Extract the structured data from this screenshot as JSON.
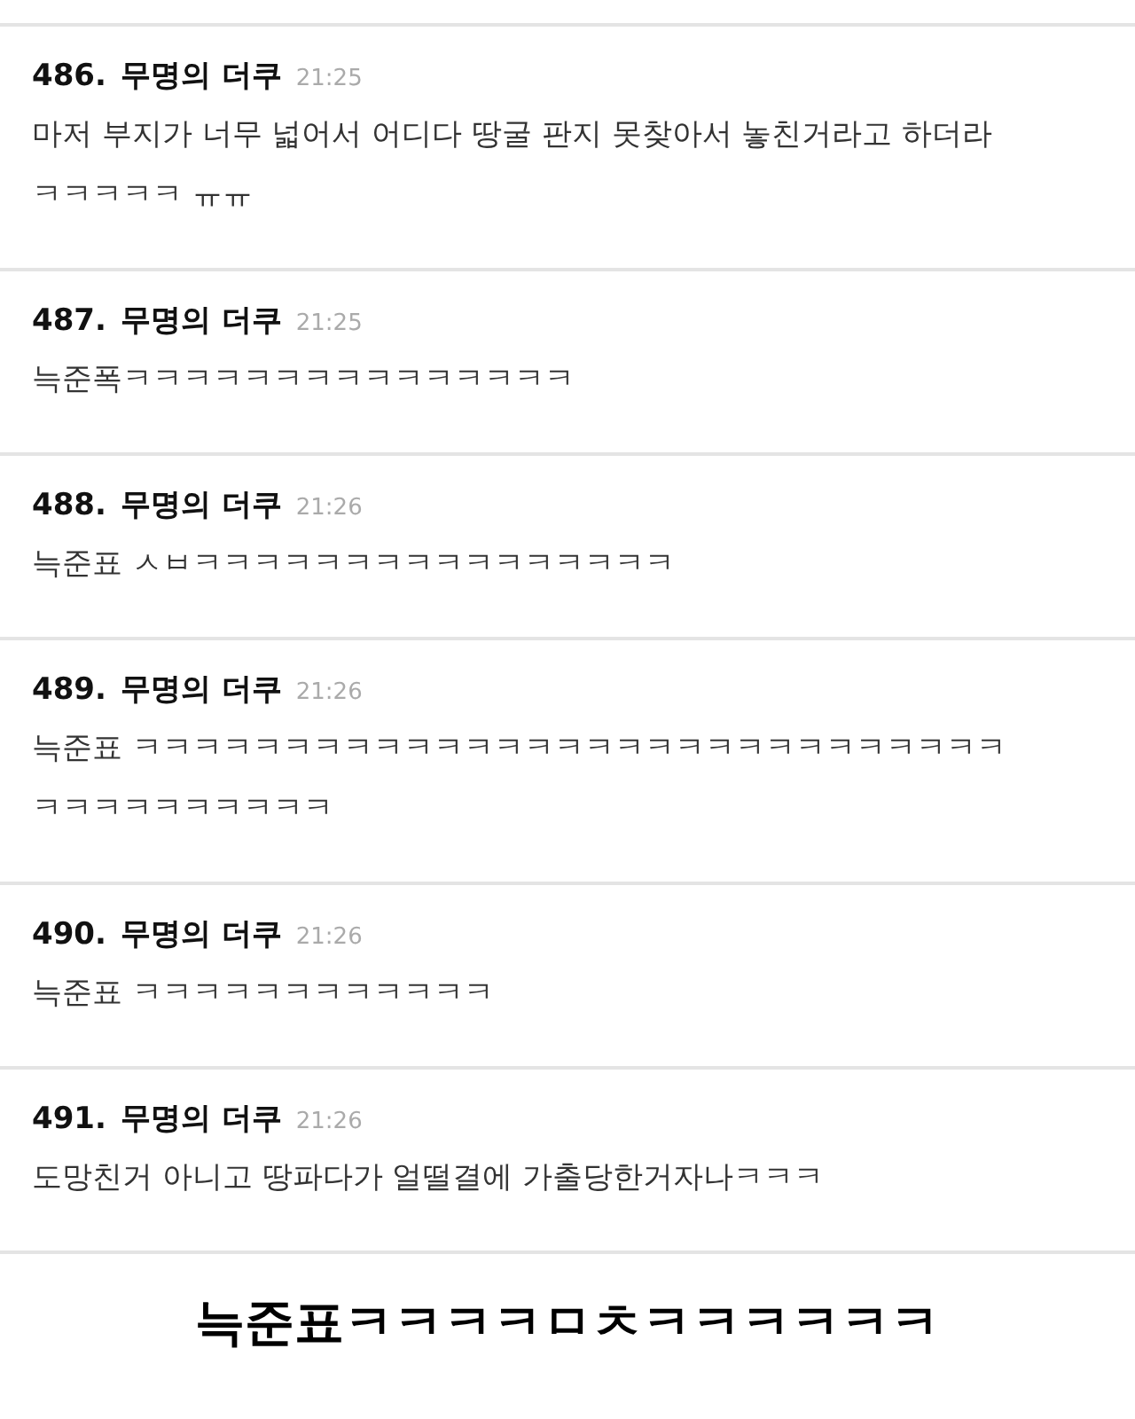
{
  "comments": [
    {
      "number": "486.",
      "author": "무명의 더쿠",
      "time": "21:25",
      "lines": [
        "마저 부지가 너무 넓어서 어디다 땅굴 판지 못찾아서 놓친거라고 하더라",
        "ㅋㅋㅋㅋㅋ ㅠㅠ"
      ]
    },
    {
      "number": "487.",
      "author": "무명의 더쿠",
      "time": "21:25",
      "lines": [
        "늑준폭ㅋㅋㅋㅋㅋㅋㅋㅋㅋㅋㅋㅋㅋㅋㅋ"
      ]
    },
    {
      "number": "488.",
      "author": "무명의 더쿠",
      "time": "21:26",
      "lines": [
        "늑준표 ㅅㅂㅋㅋㅋㅋㅋㅋㅋㅋㅋㅋㅋㅋㅋㅋㅋㅋ"
      ]
    },
    {
      "number": "489.",
      "author": "무명의 더쿠",
      "time": "21:26",
      "lines": [
        "늑준표 ㅋㅋㅋㅋㅋㅋㅋㅋㅋㅋㅋㅋㅋㅋㅋㅋㅋㅋㅋㅋㅋㅋㅋㅋㅋㅋㅋㅋㅋ",
        "ㅋㅋㅋㅋㅋㅋㅋㅋㅋㅋ"
      ]
    },
    {
      "number": "490.",
      "author": "무명의 더쿠",
      "time": "21:26",
      "lines": [
        "늑준표 ㅋㅋㅋㅋㅋㅋㅋㅋㅋㅋㅋㅋ"
      ]
    },
    {
      "number": "491.",
      "author": "무명의 더쿠",
      "time": "21:26",
      "lines": [
        "도망친거 아니고 땅파다가 얼떨결에 가출당한거자나ㅋㅋㅋ"
      ]
    }
  ],
  "caption": "늑준표ㅋㅋㅋㅋㅁㅊㅋㅋㅋㅋㅋㅋ"
}
